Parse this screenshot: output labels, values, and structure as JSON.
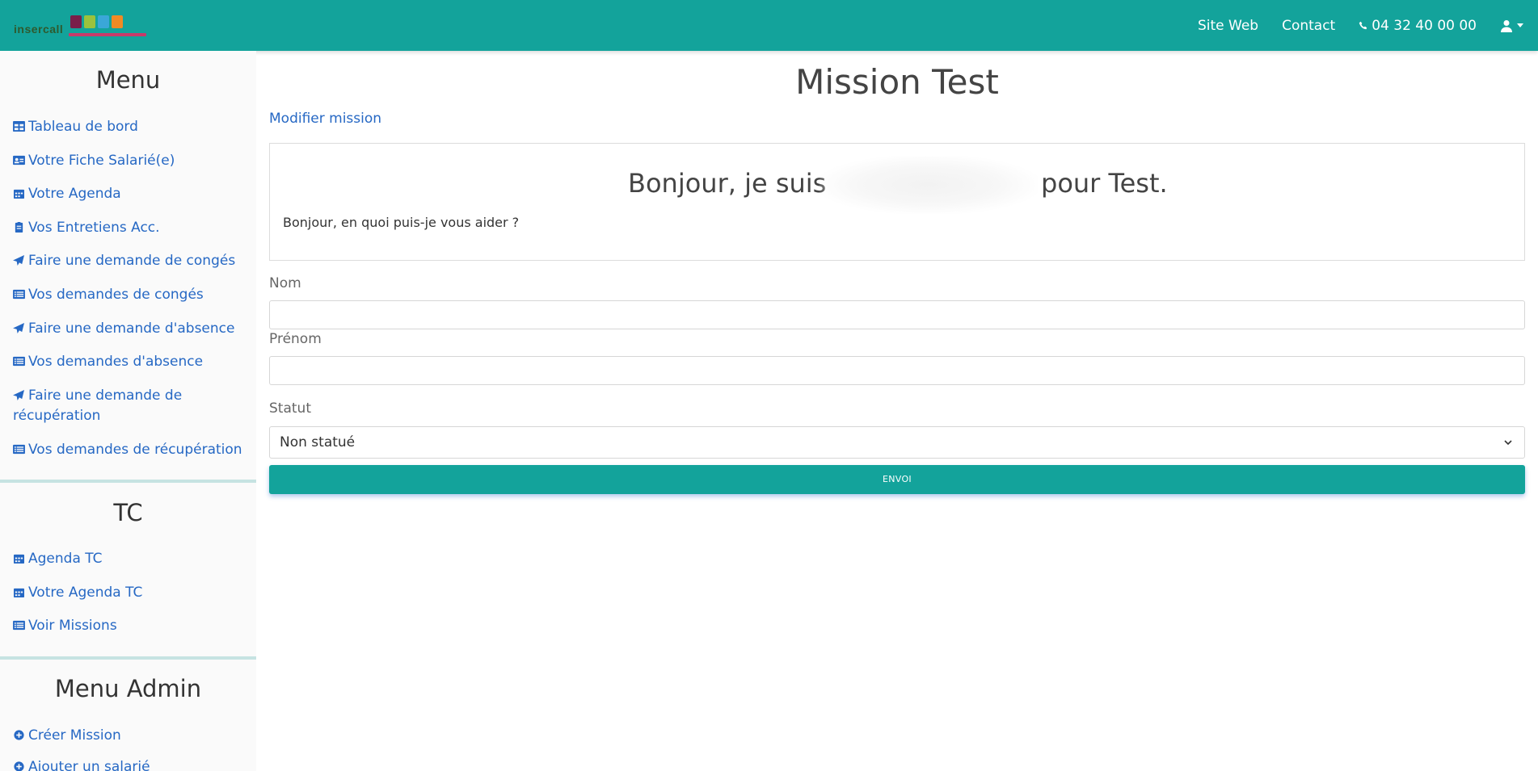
{
  "brand": {
    "logo_text": "insercall"
  },
  "nav": {
    "site_web": "Site Web",
    "contact": "Contact",
    "phone": "04 32 40 00 00"
  },
  "sidebar": {
    "menu_title": "Menu",
    "menu_items": [
      {
        "label": "Tableau de bord",
        "icon": "table-icon"
      },
      {
        "label": "Votre Fiche Salarié(e)",
        "icon": "id-card-icon"
      },
      {
        "label": "Votre Agenda",
        "icon": "calendar-icon"
      },
      {
        "label": "Vos Entretiens Acc.",
        "icon": "clipboard-icon"
      },
      {
        "label": "Faire une demande de congés",
        "icon": "paper-plane-icon"
      },
      {
        "label": "Vos demandes de congés",
        "icon": "list-icon"
      },
      {
        "label": "Faire une demande d'absence",
        "icon": "paper-plane-icon"
      },
      {
        "label": "Vos demandes d'absence",
        "icon": "list-icon"
      },
      {
        "label": "Faire une demande de récupération",
        "icon": "paper-plane-icon"
      },
      {
        "label": "Vos demandes de récupération",
        "icon": "list-icon"
      }
    ],
    "tc_title": "TC",
    "tc_items": [
      {
        "label": "Agenda TC",
        "icon": "calendar-icon"
      },
      {
        "label": "Votre Agenda TC",
        "icon": "calendar-icon"
      },
      {
        "label": "Voir Missions",
        "icon": "list-icon"
      }
    ],
    "admin_title": "Menu Admin",
    "admin_items": [
      {
        "label": "Créer Mission",
        "icon": "plus-circle-icon"
      },
      {
        "label": "Ajouter un salarié",
        "icon": "plus-circle-icon"
      }
    ]
  },
  "main": {
    "title": "Mission Test",
    "edit_link": "Modifier mission",
    "greeting_start": "Bonjour, je suis",
    "greeting_end": "pour Test.",
    "message": "Bonjour, en quoi puis-je vous aider ?",
    "form": {
      "nom_label": "Nom",
      "nom_value": "",
      "prenom_label": "Prénom",
      "prenom_value": "",
      "statut_label": "Statut",
      "statut_value": "Non statué",
      "submit_label": "ENVOI"
    }
  },
  "colors": {
    "primary": "#13a39b",
    "link": "#2668c4"
  }
}
